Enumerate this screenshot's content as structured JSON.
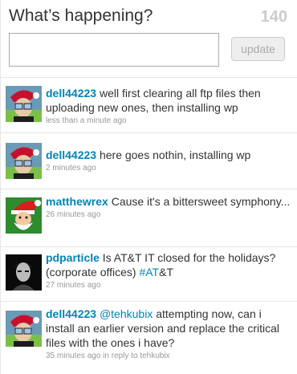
{
  "composer": {
    "prompt": "What’s happening?",
    "char_count": "140",
    "input_placeholder": "",
    "update_label": "update"
  },
  "tweets": [
    {
      "screen_name": "dell44223",
      "text": "well first clearing all ftp files then uploading new ones, then installing wp",
      "timestamp": "less than a minute ago"
    },
    {
      "screen_name": "dell44223",
      "text": "here goes nothin, installing wp",
      "timestamp": "2 minutes ago"
    },
    {
      "screen_name": "matthewrex",
      "text": "Cause it's a bittersweet symphony...",
      "timestamp": "26 minutes ago"
    },
    {
      "screen_name": "pdparticle",
      "text_before": "Is AT&T IT closed for the holidays? (corporate offices)",
      "hashtag": "#AT",
      "text_after": "&T",
      "timestamp": "27 minutes ago"
    },
    {
      "screen_name": "dell44223",
      "mention": "@tehkubix",
      "text": "attempting now, can i install an earlier version and replace the critical files with the ones i have?",
      "timestamp": "35 minutes ago",
      "reply_prefix": "in reply to",
      "reply_to": "tehkubix"
    }
  ],
  "colors": {
    "link": "#0084b4",
    "text": "#333333",
    "meta": "#999999",
    "counter": "#cccccc"
  }
}
